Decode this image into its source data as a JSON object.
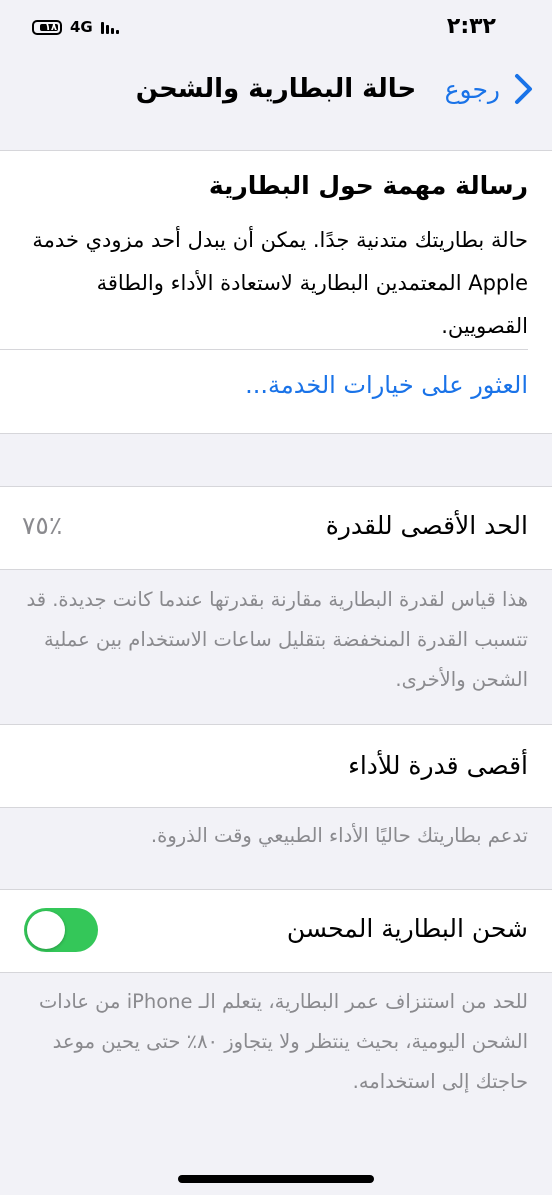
{
  "status_bar": {
    "time": "٢:٣٢",
    "network": "4G",
    "battery_level_text": "١٨"
  },
  "nav": {
    "title": "حالة البطارية والشحن",
    "back_label": "رجوع"
  },
  "important_message": {
    "title": "رسالة مهمة حول البطارية",
    "body": "حالة بطاريتك متدنية جدًا. يمكن أن يبدل أحد مزودي خدمة Apple المعتمدين البطارية لاستعادة الأداء والطاقة القصويين.",
    "link": "العثور على خيارات الخدمة..."
  },
  "max_capacity": {
    "label": "الحد الأقصى للقدرة",
    "value": "٧٥٪",
    "footer": "هذا قياس لقدرة البطارية مقارنة بقدرتها عندما كانت جديدة. قد تتسبب القدرة المنخفضة بتقليل ساعات الاستخدام بين عملية الشحن والأخرى."
  },
  "peak_performance": {
    "label": "أقصى قدرة للأداء",
    "footer": "تدعم بطاريتك حاليًا الأداء الطبيعي وقت الذروة."
  },
  "optimized_charging": {
    "label": "شحن البطارية المحسن",
    "toggle_on": true,
    "footer": "للحد من استنزاف عمر البطارية، يتعلم الـ iPhone من عادات الشحن اليومية، بحيث ينتظر ولا يتجاوز ٨٠٪ حتى يحين موعد حاجتك إلى استخدامه."
  },
  "colors": {
    "accent": "#1a73e8",
    "toggle_on": "#34c759",
    "background": "#f2f2f7",
    "secondary_text": "#8a8a8e"
  },
  "icons": [
    "chevron-left-icon",
    "battery-icon",
    "signal-icon"
  ]
}
